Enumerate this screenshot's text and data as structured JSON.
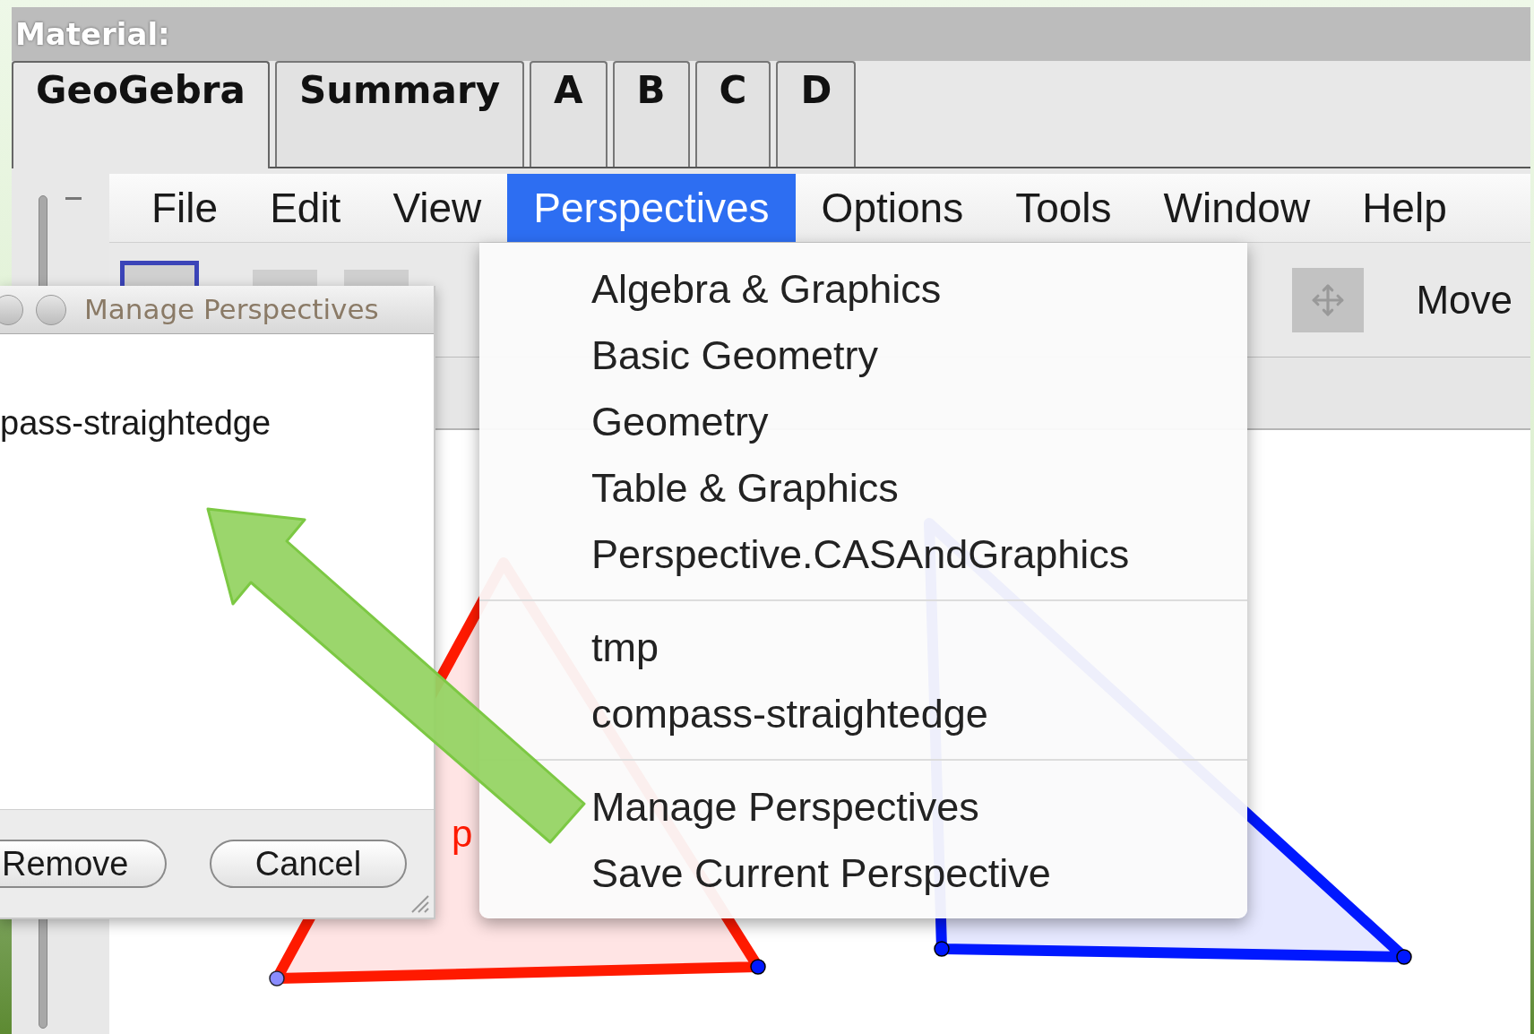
{
  "header": {
    "label": "Material:"
  },
  "tabs": [
    {
      "label": "GeoGebra",
      "selected": true
    },
    {
      "label": "Summary",
      "selected": false
    },
    {
      "label": "A",
      "selected": false
    },
    {
      "label": "B",
      "selected": false
    },
    {
      "label": "C",
      "selected": false
    },
    {
      "label": "D",
      "selected": false
    }
  ],
  "menubar": [
    {
      "label": "File",
      "selected": false
    },
    {
      "label": "Edit",
      "selected": false
    },
    {
      "label": "View",
      "selected": false
    },
    {
      "label": "Perspectives",
      "selected": true
    },
    {
      "label": "Options",
      "selected": false
    },
    {
      "label": "Tools",
      "selected": false
    },
    {
      "label": "Window",
      "selected": false
    },
    {
      "label": "Help",
      "selected": false
    }
  ],
  "toolbar": {
    "tool_label": "Move"
  },
  "perspectives_menu": {
    "groups": [
      [
        "Algebra & Graphics",
        "Basic Geometry",
        "Geometry",
        "Table & Graphics",
        "Perspective.CASAndGraphics"
      ],
      [
        "tmp",
        "compass-straightedge"
      ],
      [
        "Manage Perspectives",
        "Save Current Perspective"
      ]
    ]
  },
  "dialog": {
    "title": "Manage Perspectives",
    "items": [
      "pass-straightedge"
    ],
    "buttons": [
      "Remove",
      "Cancel"
    ]
  },
  "canvas": {
    "labels": [
      "p"
    ]
  }
}
